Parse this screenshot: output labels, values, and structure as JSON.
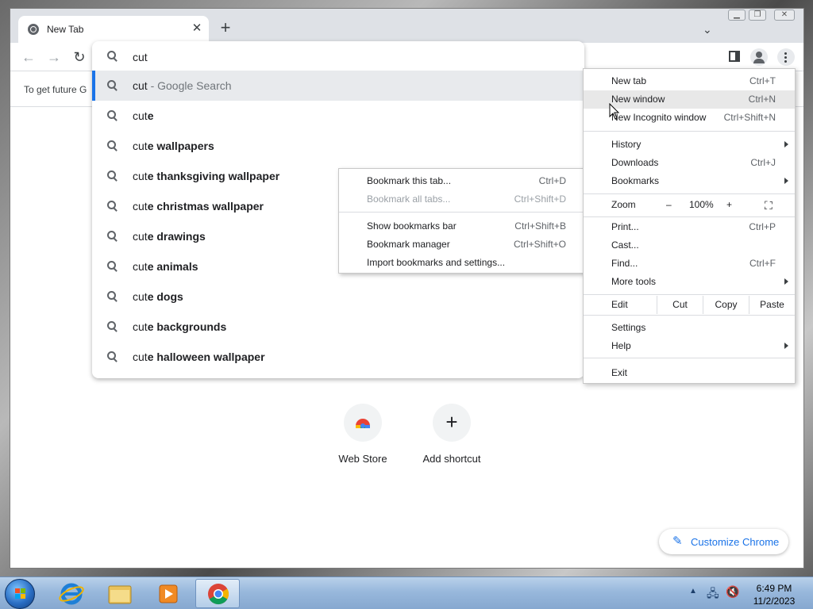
{
  "browser": {
    "tab": {
      "title": "New Tab"
    },
    "omnibox": {
      "query": "cut",
      "suggestions": [
        {
          "typed": "cut",
          "completion": "",
          "extra": " - Google Search"
        },
        {
          "typed": "cut",
          "completion": "e",
          "extra": ""
        },
        {
          "typed": "cut",
          "completion": "e wallpapers",
          "extra": ""
        },
        {
          "typed": "cut",
          "completion": "e thanksgiving wallpaper",
          "extra": ""
        },
        {
          "typed": "cut",
          "completion": "e christmas wallpaper",
          "extra": ""
        },
        {
          "typed": "cut",
          "completion": "e drawings",
          "extra": ""
        },
        {
          "typed": "cut",
          "completion": "e animals",
          "extra": ""
        },
        {
          "typed": "cut",
          "completion": "e dogs",
          "extra": ""
        },
        {
          "typed": "cut",
          "completion": "e backgrounds",
          "extra": ""
        },
        {
          "typed": "cut",
          "completion": "e halloween wallpaper",
          "extra": ""
        }
      ]
    },
    "infobar": {
      "text": "To get future G"
    }
  },
  "bookmarks_menu": {
    "items": [
      {
        "label": "Bookmark this tab...",
        "shortcut": "Ctrl+D"
      },
      {
        "label": "Bookmark all tabs...",
        "shortcut": "Ctrl+Shift+D"
      },
      {
        "label": "Show bookmarks bar",
        "shortcut": "Ctrl+Shift+B"
      },
      {
        "label": "Bookmark manager",
        "shortcut": "Ctrl+Shift+O"
      },
      {
        "label": "Import bookmarks and settings...",
        "shortcut": ""
      }
    ]
  },
  "main_menu": {
    "new_tab": {
      "label": "New tab",
      "shortcut": "Ctrl+T"
    },
    "new_window": {
      "label": "New window",
      "shortcut": "Ctrl+N"
    },
    "new_incognito": {
      "label": "New Incognito window",
      "shortcut": "Ctrl+Shift+N"
    },
    "history": {
      "label": "History"
    },
    "downloads": {
      "label": "Downloads",
      "shortcut": "Ctrl+J"
    },
    "bookmarks": {
      "label": "Bookmarks"
    },
    "zoom": {
      "label": "Zoom",
      "minus": "–",
      "level": "100%",
      "plus": "+"
    },
    "print": {
      "label": "Print...",
      "shortcut": "Ctrl+P"
    },
    "cast": {
      "label": "Cast..."
    },
    "find": {
      "label": "Find...",
      "shortcut": "Ctrl+F"
    },
    "more_tools": {
      "label": "More tools"
    },
    "edit": {
      "label": "Edit",
      "cut": "Cut",
      "copy": "Copy",
      "paste": "Paste"
    },
    "settings": {
      "label": "Settings"
    },
    "help": {
      "label": "Help"
    },
    "exit": {
      "label": "Exit"
    }
  },
  "ntp": {
    "shortcuts": [
      {
        "label": "Web Store"
      },
      {
        "label": "Add shortcut"
      }
    ],
    "customize_label": "Customize Chrome"
  },
  "taskbar": {
    "time": "6:49 PM",
    "date": "11/2/2023"
  }
}
